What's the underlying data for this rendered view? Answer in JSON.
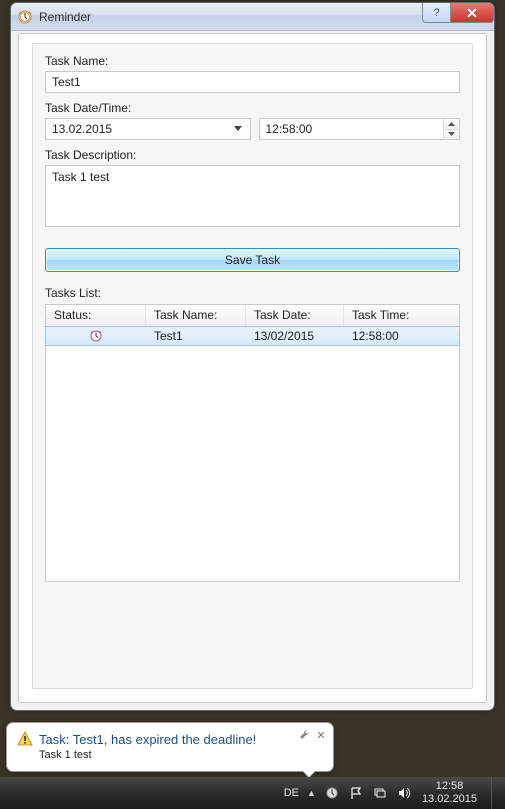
{
  "window": {
    "title": "Reminder"
  },
  "form": {
    "task_name_label": "Task Name:",
    "task_name_value": "Test1",
    "task_datetime_label": "Task Date/Time:",
    "task_date_value": "13.02.2015",
    "task_time_value": "12:58:00",
    "task_description_label": "Task Description:",
    "task_description_value": "Task 1 test",
    "save_button_label": "Save Task",
    "tasks_list_label": "Tasks List:"
  },
  "table": {
    "headers": {
      "status": "Status:",
      "name": "Task Name:",
      "date": "Task Date:",
      "time": "Task Time:"
    },
    "rows": [
      {
        "status_icon": "clock",
        "name": "Test1",
        "date": "13/02/2015",
        "time": "12:58:00"
      }
    ]
  },
  "notification": {
    "title": "Task: Test1, has expired the deadline!",
    "body": "Task 1 test"
  },
  "taskbar": {
    "language": "DE",
    "time": "12:58",
    "date": "13.02.2015"
  }
}
